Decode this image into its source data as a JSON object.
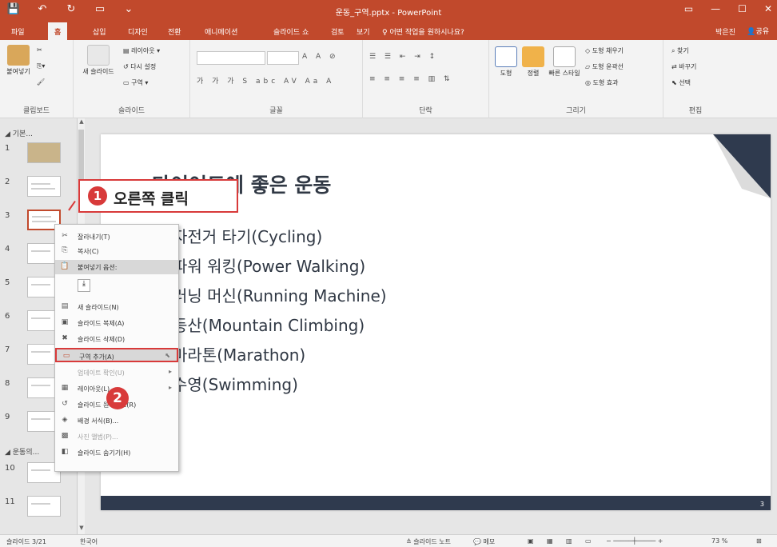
{
  "window": {
    "title": "운동_구역.pptx - PowerPoint",
    "user": "박은진",
    "share": "공유",
    "quick_access": [
      "💾",
      "↶",
      "↻",
      "▭",
      "⌄"
    ],
    "controls": [
      "▭",
      "—",
      "☐",
      "✕"
    ]
  },
  "tabs": [
    "파일",
    "홈",
    "삽입",
    "디자인",
    "전환",
    "애니메이션",
    "슬라이드 쇼",
    "검토",
    "보기"
  ],
  "active_tab": "홈",
  "tellme": "♀ 어떤 작업을 원하시나요?",
  "ribbon": {
    "clipboard": {
      "label": "클립보드",
      "paste": "붙여넣기"
    },
    "slides": {
      "label": "슬라이드",
      "new_slide": "새 슬라이드",
      "layout": "레이아웃",
      "reset": "다시 설정",
      "section": "구역"
    },
    "font": {
      "label": "글꼴"
    },
    "paragraph": {
      "label": "단락"
    },
    "drawing": {
      "label": "그리기",
      "shapes": "도형",
      "arrange": "정렬",
      "quick_styles": "빠른 스타일",
      "fill": "도형 채우기",
      "outline": "도형 윤곽선",
      "effects": "도형 효과"
    },
    "editing": {
      "label": "편집",
      "find": "찾기",
      "replace": "바꾸기",
      "select": "선택"
    }
  },
  "thumbnails": {
    "section1": "◢ 기본...",
    "section2": "◢ 운동의...",
    "numbers": [
      "1",
      "2",
      "3",
      "4",
      "5",
      "6",
      "7",
      "8",
      "9",
      "10",
      "11"
    ]
  },
  "slide": {
    "title": "다이어트에 좋은 운동",
    "bullets": [
      "자전거 타기(Cycling)",
      "파워 워킹(Power Walking)",
      "러닝 머신(Running Machine)",
      "등산(Mountain Climbing)",
      "마라톤(Marathon)",
      "수영(Swimming)"
    ],
    "page": "3"
  },
  "context_menu": {
    "items": [
      {
        "icon": "✂",
        "label": "잘라내기(T)"
      },
      {
        "icon": "⎘",
        "label": "복사(C)"
      },
      {
        "icon": "📋",
        "label": "붙여넣기 옵션:"
      },
      {
        "icon": "",
        "label": ""
      },
      {
        "icon": "▤",
        "label": "새 슬라이드(N)"
      },
      {
        "icon": "▣",
        "label": "슬라이드 복제(A)"
      },
      {
        "icon": "✖",
        "label": "슬라이드 삭제(D)"
      },
      {
        "icon": "▭",
        "label": "구역 추가(A)"
      },
      {
        "icon": "",
        "label": "업데이트 확인(U)"
      },
      {
        "icon": "▦",
        "label": "레이아웃(L)"
      },
      {
        "icon": "↺",
        "label": "슬라이드 원래대로(R)"
      },
      {
        "icon": "◈",
        "label": "배경 서식(B)..."
      },
      {
        "icon": "▩",
        "label": "사진 앨범(P)..."
      },
      {
        "icon": "◧",
        "label": "슬라이드 숨기기(H)"
      }
    ]
  },
  "callouts": {
    "step1_num": "1",
    "step1_text": "오른쪽 클릭",
    "step2_num": "2"
  },
  "statusbar": {
    "slide_info": "슬라이드 3/21",
    "language": "한국어",
    "notes": "≙ 슬라이드 노트",
    "comments": "💬 메모",
    "zoom": "73 %"
  },
  "colors": {
    "accent": "#c1492c",
    "callout": "#d83a3a",
    "slide_dark": "#2f3a4e"
  }
}
